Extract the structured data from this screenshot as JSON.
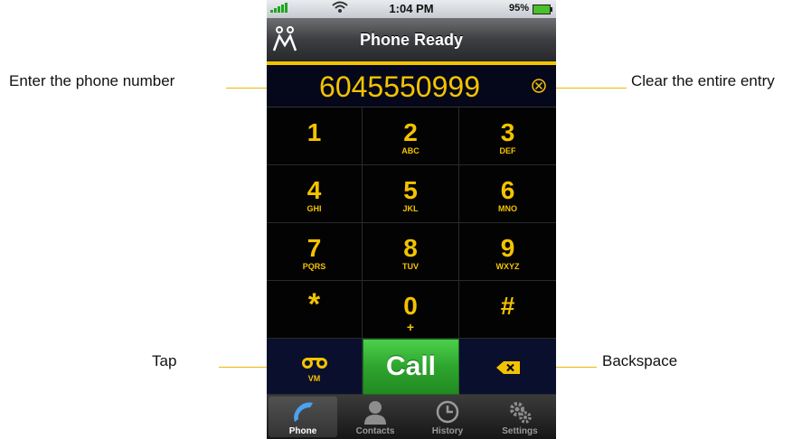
{
  "callouts": {
    "enter_number": "Enter the phone number",
    "clear_entry": "Clear the entire entry",
    "tap": "Tap",
    "backspace": "Backspace"
  },
  "status_bar": {
    "time": "1:04 PM",
    "battery": "95%",
    "icons": [
      "signal-icon",
      "wifi-icon",
      "battery-icon"
    ]
  },
  "nav": {
    "title": "Phone Ready",
    "logo_icon": "people-logo-icon"
  },
  "entry": {
    "value": "6045550999",
    "clear_icon": "clear-circle-icon"
  },
  "keypad": {
    "keys": [
      {
        "digit": "1",
        "letters": ""
      },
      {
        "digit": "2",
        "letters": "ABC"
      },
      {
        "digit": "3",
        "letters": "DEF"
      },
      {
        "digit": "4",
        "letters": "GHI"
      },
      {
        "digit": "5",
        "letters": "JKL"
      },
      {
        "digit": "6",
        "letters": "MNO"
      },
      {
        "digit": "7",
        "letters": "PQRS"
      },
      {
        "digit": "8",
        "letters": "TUV"
      },
      {
        "digit": "9",
        "letters": "WXYZ"
      },
      {
        "digit": "*",
        "letters": ""
      },
      {
        "digit": "0",
        "letters": "+"
      },
      {
        "digit": "#",
        "letters": ""
      }
    ],
    "vm_label": "VM",
    "call_label": "Call",
    "backspace_icon": "backspace-icon"
  },
  "tabs": [
    {
      "label": "Phone",
      "icon": "phone-icon",
      "active": true
    },
    {
      "label": "Contacts",
      "icon": "contacts-icon",
      "active": false
    },
    {
      "label": "History",
      "icon": "clock-icon",
      "active": false
    },
    {
      "label": "Settings",
      "icon": "gear-icon",
      "active": false
    }
  ],
  "colors": {
    "accent": "#f3c300",
    "call_green": "#2ea52e"
  }
}
